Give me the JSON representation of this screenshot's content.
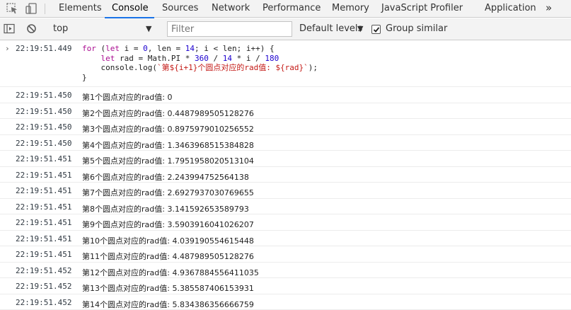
{
  "tabs": [
    {
      "label": "Elements",
      "active": false
    },
    {
      "label": "Console",
      "active": true
    },
    {
      "label": "Sources",
      "active": false
    },
    {
      "label": "Network",
      "active": false
    },
    {
      "label": "Performance",
      "active": false
    },
    {
      "label": "Memory",
      "active": false
    },
    {
      "label": "JavaScript Profiler",
      "active": false
    },
    {
      "label": "Application",
      "active": false
    }
  ],
  "more_tabs": "»",
  "toolbar": {
    "context": "top",
    "filter_placeholder": "Filter",
    "levels": "Default levels",
    "group_similar": "Group similar",
    "group_similar_checked": true
  },
  "input": {
    "timestamp": "22:19:51.449",
    "code_lines": [
      "for (let i = 0, len = 14; i < len; i++) {",
      "    let rad = Math.PI * 360 / 14 * i / 180",
      "    console.log(`第${i+1}个圆点对应的rad值: ${rad}`);",
      "}"
    ]
  },
  "logs": [
    {
      "timestamp": "22:19:51.450",
      "text": "第1个圆点对应的rad值: 0"
    },
    {
      "timestamp": "22:19:51.450",
      "text": "第2个圆点对应的rad值: 0.4487989505128276"
    },
    {
      "timestamp": "22:19:51.450",
      "text": "第3个圆点对应的rad值: 0.8975979010256552"
    },
    {
      "timestamp": "22:19:51.450",
      "text": "第4个圆点对应的rad值: 1.3463968515384828"
    },
    {
      "timestamp": "22:19:51.451",
      "text": "第5个圆点对应的rad值: 1.7951958020513104"
    },
    {
      "timestamp": "22:19:51.451",
      "text": "第6个圆点对应的rad值: 2.243994752564138"
    },
    {
      "timestamp": "22:19:51.451",
      "text": "第7个圆点对应的rad值: 2.6927937030769655"
    },
    {
      "timestamp": "22:19:51.451",
      "text": "第8个圆点对应的rad值: 3.141592653589793"
    },
    {
      "timestamp": "22:19:51.451",
      "text": "第9个圆点对应的rad值: 3.5903916041026207"
    },
    {
      "timestamp": "22:19:51.451",
      "text": "第10个圆点对应的rad值: 4.039190554615448"
    },
    {
      "timestamp": "22:19:51.451",
      "text": "第11个圆点对应的rad值: 4.487989505128276"
    },
    {
      "timestamp": "22:19:51.452",
      "text": "第12个圆点对应的rad值: 4.9367884556411035"
    },
    {
      "timestamp": "22:19:51.452",
      "text": "第13个圆点对应的rad值: 5.385587406153931"
    },
    {
      "timestamp": "22:19:51.452",
      "text": "第14个圆点对应的rad值: 5.834386356666759"
    }
  ],
  "colors": {
    "accent": "#1a73e8",
    "keyword": "#aa0d91",
    "number": "#1c00cf",
    "string": "#c41a16",
    "toolbar_bg": "#f3f3f3"
  },
  "icons": {
    "inspect": "inspect-element-icon",
    "device": "device-toolbar-icon",
    "sidebar": "show-sidebar-icon",
    "clear": "clear-console-icon",
    "dropdown": "dropdown-arrow-icon",
    "more": "more-tabs-icon",
    "prompt": "input-prompt-icon"
  }
}
